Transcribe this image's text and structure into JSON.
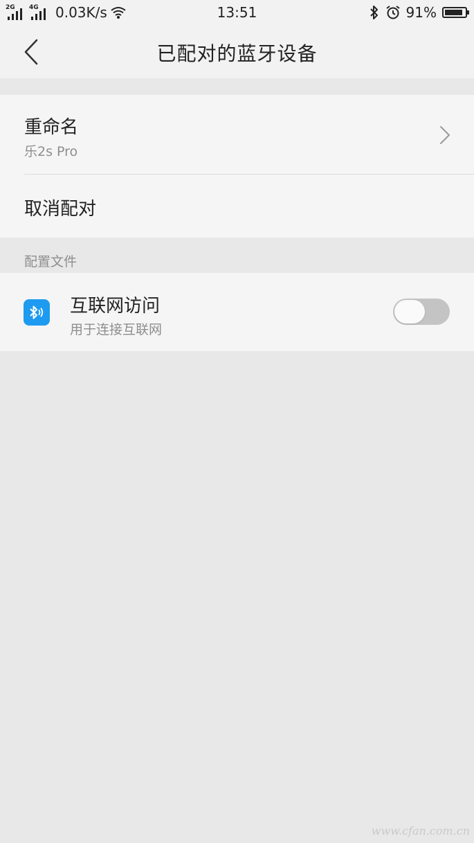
{
  "status_bar": {
    "sim1_tag": "2G",
    "sim2_tag": "4G",
    "net_speed": "0.03K/s",
    "time": "13:51",
    "battery_percent": "91%",
    "battery_level": 0.91
  },
  "header": {
    "title": "已配对的蓝牙设备"
  },
  "device": {
    "rename_label": "重命名",
    "device_name": "乐2s Pro",
    "unpair_label": "取消配对"
  },
  "profiles": {
    "section_label": "配置文件",
    "items": [
      {
        "title": "互联网访问",
        "subtitle": "用于连接互联网",
        "enabled": false,
        "icon": "bluetooth-icon",
        "icon_color": "#1e9bf0"
      }
    ]
  },
  "watermark": "www.cfan.com.cn"
}
